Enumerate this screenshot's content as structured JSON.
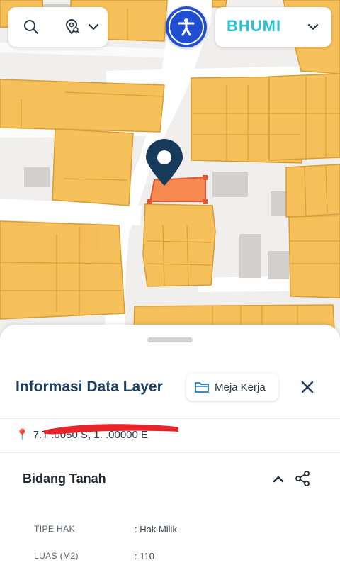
{
  "map": {
    "colors": {
      "background": "#f0efee",
      "road": "#ffffff",
      "parcel_fill": "#f6bd52",
      "parcel_stroke": "#d59a2c",
      "selected_parcel": "#f6894f",
      "selected_stroke": "#e4572e",
      "marker": "#163b5a",
      "building": "#d2cfcc"
    },
    "marker_icon": "location-pin-icon"
  },
  "toolbar": {
    "search_icon": "search-icon",
    "location_filter_icon": "location-filter-icon",
    "dropdown_icon": "chevron-down-icon",
    "accessibility_icon": "accessibility-icon",
    "accessibility_color": "#1f4fd0",
    "brand_logo": "BHUMI",
    "brand_color": "#29c0d8"
  },
  "sheet": {
    "title": "Informasi Data Layer",
    "meja_kerja_label": "Meja Kerja",
    "meja_icon": "folder-icon",
    "close_icon": "close-icon",
    "coordinate_visible": "7.T  .0050 S, 1.  .00000 E",
    "section_title": "Bidang Tanah",
    "collapse_icon": "chevron-up-icon",
    "share_icon": "share-icon",
    "accent_color": "#1d3f63",
    "rows": [
      {
        "label": "TIPE HAK",
        "value": ": Hak Milik"
      },
      {
        "label": "LUAS (M2)",
        "value": ": 110"
      }
    ]
  }
}
